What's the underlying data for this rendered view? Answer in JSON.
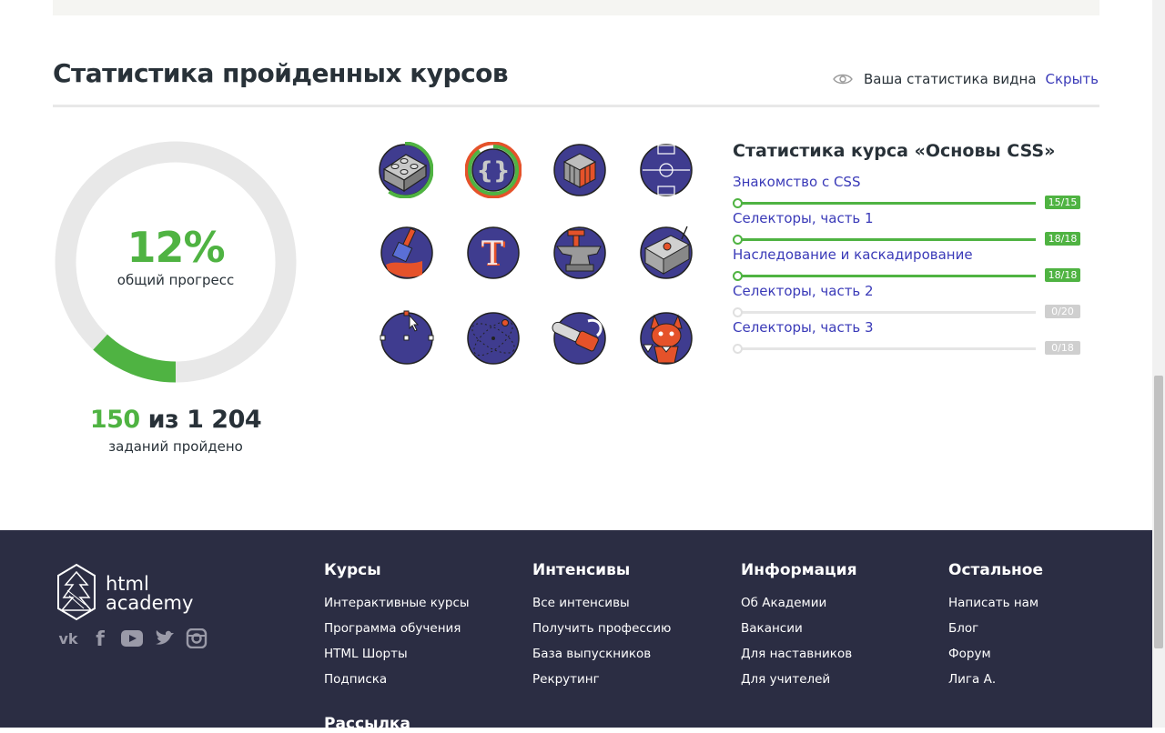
{
  "stats": {
    "title": "Статистика пройденных курсов",
    "visibility_text": "Ваша статистика видна",
    "hide_link": "Скрыть"
  },
  "progress": {
    "percent": "12%",
    "label": "общий прогресс",
    "fraction": 0.12,
    "done": "150",
    "of_text": " из ",
    "total": "1 204",
    "tasks_label": "заданий пройдено",
    "accent_color": "#4fb342"
  },
  "badges": [
    {
      "icon": "lego-brick-icon",
      "progress": 0.6
    },
    {
      "icon": "curly-braces-icon",
      "progress": 0.9
    },
    {
      "icon": "rubiks-cube-icon",
      "progress": 0
    },
    {
      "icon": "football-field-icon",
      "progress": 0
    },
    {
      "icon": "paint-brush-icon",
      "progress": 0
    },
    {
      "icon": "typography-icon",
      "progress": 0
    },
    {
      "icon": "anvil-icon",
      "progress": 0
    },
    {
      "icon": "robot-icon",
      "progress": 0
    },
    {
      "icon": "vector-pen-icon",
      "progress": 0
    },
    {
      "icon": "orbit-icon",
      "progress": 0
    },
    {
      "icon": "chainsaw-icon",
      "progress": 0
    },
    {
      "icon": "cat-mascot-icon",
      "progress": 0
    }
  ],
  "course_stats": {
    "title": "Статистика курса «Основы CSS»",
    "chapters": [
      {
        "name": "Знакомство с CSS",
        "count": "15/15",
        "progress": 1
      },
      {
        "name": "Селекторы, часть 1",
        "count": "18/18",
        "progress": 1
      },
      {
        "name": "Наследование и каскадирование",
        "count": "18/18",
        "progress": 1
      },
      {
        "name": "Селекторы, часть 2",
        "count": "0/20",
        "progress": 0
      },
      {
        "name": "Селекторы, часть 3",
        "count": "0/18",
        "progress": 0
      }
    ]
  },
  "footer": {
    "logo_line1": "html",
    "logo_line2": "academy",
    "social": [
      "vk-icon",
      "facebook-icon",
      "youtube-icon",
      "twitter-icon",
      "instagram-icon"
    ],
    "columns": [
      {
        "title": "Курсы",
        "links": [
          "Интерактивные курсы",
          "Программа обучения",
          "HTML Шорты",
          "Подписка"
        ]
      },
      {
        "title": "Интенсивы",
        "links": [
          "Все интенсивы",
          "Получить профессию",
          "База выпускников",
          "Рекрутинг"
        ]
      },
      {
        "title": "Информация",
        "links": [
          "Об Академии",
          "Вакансии",
          "Для наставников",
          "Для учителей"
        ]
      },
      {
        "title": "Остальное",
        "links": [
          "Написать нам",
          "Блог",
          "Форум",
          "Лига А."
        ]
      }
    ],
    "newsletter_title": "Рассылка",
    "background": "#2b2d43"
  }
}
